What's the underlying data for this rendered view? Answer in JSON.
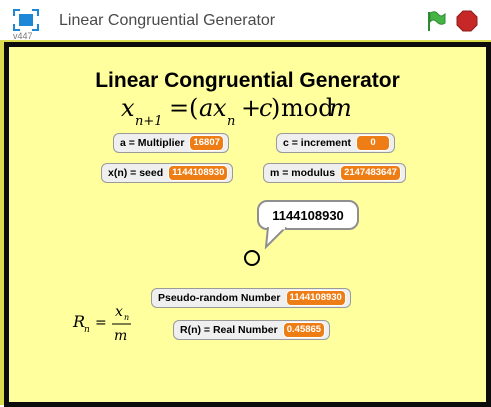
{
  "window": {
    "title": "Linear Congruential Generator",
    "version": "v447"
  },
  "stage": {
    "heading": "Linear Congruential Generator",
    "formula": {
      "x": "x",
      "sub_n1": "n+1",
      "eq": "=",
      "open": "(",
      "a": "a",
      "x2": "x",
      "sub_n": "n",
      "plus": "+",
      "c": "c",
      "close": ")",
      "mod": "mod",
      "m": "m"
    },
    "watchers": [
      {
        "label": "a = Multiplier",
        "value": "16807"
      },
      {
        "label": "c = increment",
        "value": "0"
      },
      {
        "label": "x(n) = seed",
        "value": "1144108930"
      },
      {
        "label": "m = modulus",
        "value": "2147483647"
      },
      {
        "label": "Pseudo-random Number",
        "value": "1144108930"
      },
      {
        "label": "R(n) = Real Number",
        "value": "0.45865"
      }
    ],
    "speech_bubble": "1144108930",
    "rn_formula": {
      "R": "R",
      "sub_n": "n",
      "eq": "=",
      "x": "x",
      "sub_n2": "n",
      "m": "m"
    }
  }
}
